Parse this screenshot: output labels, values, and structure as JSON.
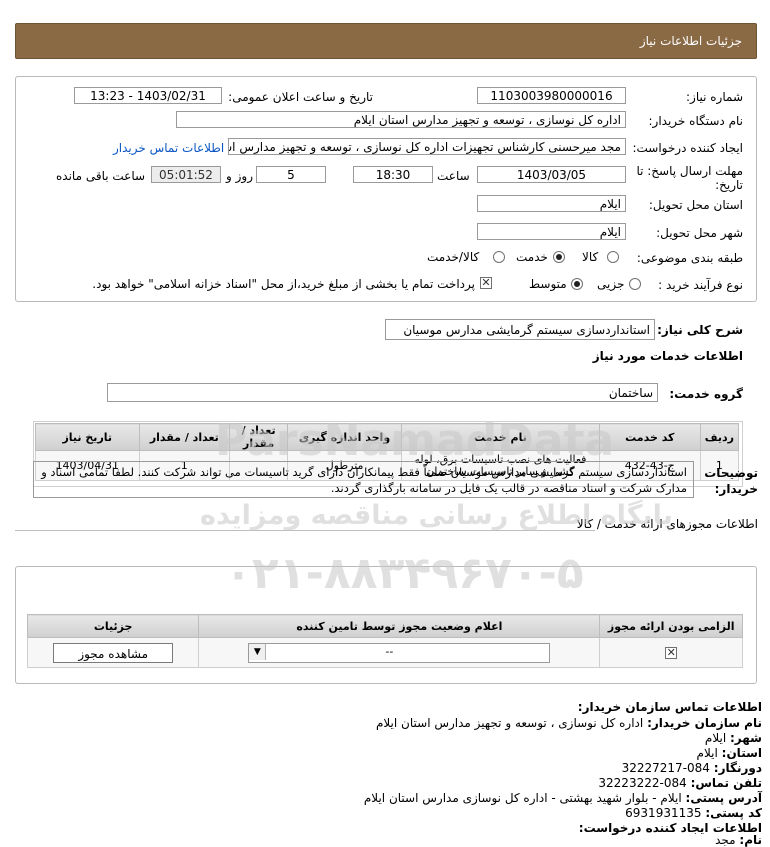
{
  "header": {
    "title": "جزئیات اطلاعات نیاز"
  },
  "form": {
    "need_number_label": "شماره نیاز:",
    "need_number": "1103003980000016",
    "announce_label": "تاریخ و ساعت اعلان عمومی:",
    "announce_value": "1403/02/31 - 13:23",
    "buyer_org_label": "نام دستگاه خریدار:",
    "buyer_org": "اداره کل نوسازی ، توسعه و تجهیز مدارس استان ایلام",
    "creator_label": "ایجاد کننده درخواست:",
    "creator": "مجد میرحسنی کارشناس تجهیزات اداره کل نوسازی ، توسعه و تجهیز مدارس استان",
    "contact_link": "اطلاعات تماس خریدار",
    "deadline_label": "مهلت ارسال پاسخ: تا تاریخ:",
    "deadline_date": "1403/03/05",
    "time_label": "ساعت",
    "deadline_time": "18:30",
    "days_value": "5",
    "days_label": "روز و",
    "remaining_time": "05:01:52",
    "remaining_label": "ساعت باقی مانده",
    "province_label": "استان محل تحویل:",
    "province": "ایلام",
    "city_label": "شهر محل تحویل:",
    "city": "ایلام",
    "category_label": "طبقه بندی موضوعی:",
    "category_options": [
      "کالا",
      "خدمت",
      "کالا/خدمت"
    ],
    "category_selected": "خدمت",
    "process_label": "نوع فرآیند خرید :",
    "process_options": [
      "جزیی",
      "متوسط"
    ],
    "process_selected": "متوسط",
    "treasury_text": "پرداخت تمام یا بخشی از مبلغ خرید،از محل \"اسناد خزانه اسلامی\" خواهد بود."
  },
  "summary": {
    "label": "شرح کلی نیاز:",
    "value": "استانداردسازی سیستم گرمایشی مدارس موسیان"
  },
  "services": {
    "section_title": "اطلاعات خدمات مورد نیاز",
    "group_label": "گروه خدمت:",
    "group_value": "ساختمان",
    "columns": [
      "ردیف",
      "کد خدمت",
      "نام خدمت",
      "واحد اندازه گیری",
      "تعداد / مقدار",
      "تاریخ نیاز"
    ],
    "rows": [
      {
        "index": "1",
        "code": "ج-43-432",
        "name": "فعالیت های نصب تاسیسات برق، لوله کشی و سایر تاسیسات ساختمان",
        "unit": "مترطول",
        "qty": "1",
        "date": "1403/04/31"
      }
    ]
  },
  "buyer_notes": {
    "label": "توضیحات خریدار:",
    "text": "استانداردسازی سیستم گرمایشی مدارس موسیان ضمناً فقط پیمانکاران دارای گرید تاسیسات می تواند شرکت کنند. لطفا تمامی اسناد و مدارک شرکت و اسناد مناقصه در قالب یک فایل در سامانه بارگذاری گردند."
  },
  "permits": {
    "section_title": "اطلاعات مجوزهای ارائه خدمت / کالا",
    "columns": [
      "الزامی بودن ارائه مجوز",
      "اعلام وضعیت مجوز توسط تامین کننده",
      "جزئیات"
    ],
    "row": {
      "status_value": "--",
      "details_button": "مشاهده مجوز"
    }
  },
  "contact": {
    "title": "اطلاعات تماس سازمان خریدار:",
    "org_label": "نام سازمان خریدار:",
    "org_value": "اداره کل نوسازی ، توسعه و تجهیز مدارس استان ایلام",
    "city_label": "شهر:",
    "city_value": "ایلام",
    "province_label": "استان:",
    "province_value": "ایلام",
    "fax_label": "دورنگار:",
    "fax_value": "084-32227217",
    "phone_label": "تلفن تماس:",
    "phone_value": "084-32223222",
    "address_label": "آدرس پستی:",
    "address_value": "ایلام - بلوار شهید بهشتی - اداره کل نوسازی مدارس استان ایلام",
    "postal_label": "کد پستی:",
    "postal_value": "6931931135",
    "creator_title": "اطلاعات ایجاد کننده درخواست:",
    "name_label": "نام:",
    "name_value": "مجد"
  },
  "watermark": {
    "brand": "ParsNamadData",
    "tagline": "پایگاه اطلاع رسانی مناقصه ومزایده",
    "phone": "۰۲۱-۸۸۳۴۹۶۷۰-۵"
  }
}
